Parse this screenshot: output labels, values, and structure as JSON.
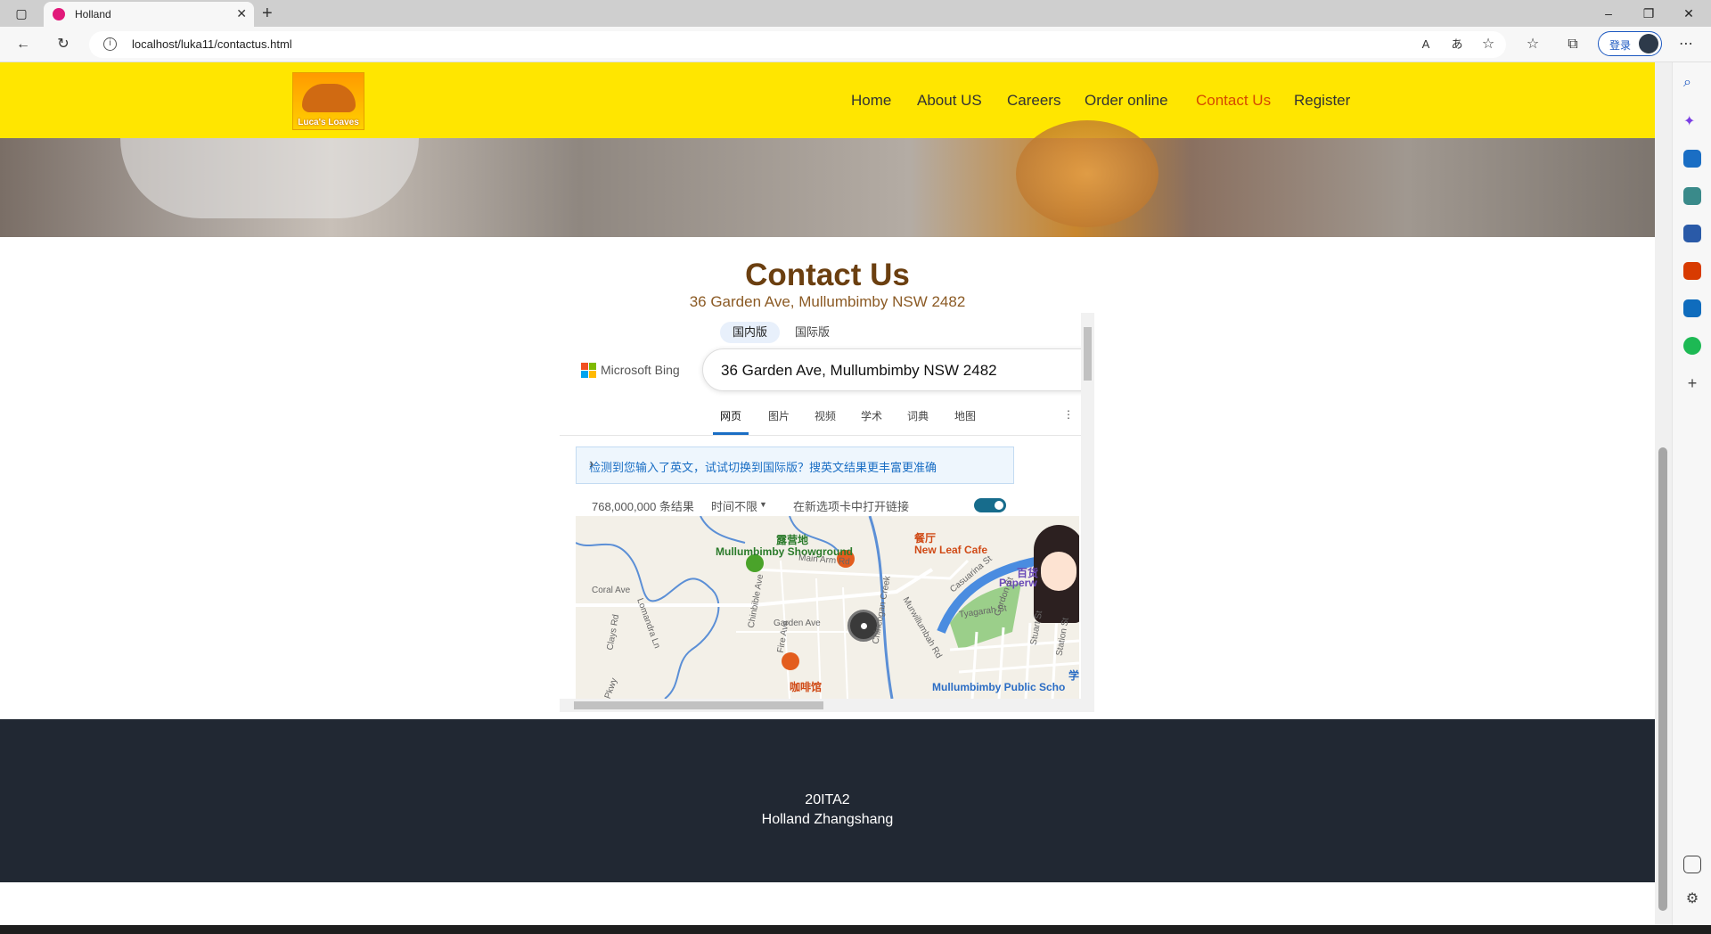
{
  "browser": {
    "tab_title": "Holland",
    "url": "localhost/luka11/contactus.html",
    "login_label": "登录"
  },
  "navbar": {
    "logo_text": "Luca's Loaves",
    "links": [
      "Home",
      "About US",
      "Careers",
      "Order online",
      "Contact Us",
      "Register"
    ],
    "active_color": "#d64a00",
    "bg_color": "#ffe600"
  },
  "content": {
    "heading": "Contact Us",
    "address": "36 Garden Ave, Mullumbimby NSW 2482"
  },
  "bing": {
    "segments": [
      "国内版",
      "国际版"
    ],
    "brand": "Microsoft Bing",
    "query": "36 Garden Ave, Mullumbimby NSW 2482",
    "scopes": [
      "网页",
      "图片",
      "视频",
      "学术",
      "词典",
      "地图"
    ],
    "notice": "检测到您输入了英文，试试切换到国际版？搜英文结果更丰富更准确",
    "result_count": "768,000,000 条结果",
    "time_filter": "时间不限",
    "new_tab_label": "在新选项卡中打开链接",
    "map_labels": {
      "campsite_cn": "露营地",
      "showground": "Mullumbimby Showground",
      "restaurant_cn": "餐厅",
      "cafe": "New Leaf Cafe",
      "coffee_cn": "咖啡馆",
      "school": "Mullumbimby Public Scho",
      "school_cn": "学",
      "paperw": "Paperw",
      "baihuo_cn": "百货",
      "main_arm": "Main Arm Rd",
      "coral": "Coral Ave",
      "garden": "Garden Ave",
      "clays": "Clays Rd",
      "lomandra": "Lomandra Ln",
      "tyagarah": "Tyagarah St",
      "stuart": "Stuart St",
      "station": "Station St",
      "gordon": "Gordon St",
      "casuarina": "Casuarina St",
      "chinbible": "Chinbible Ave",
      "fire": "Fire Ave",
      "chinchile_creek": "Chincogan Creek",
      "murwillumbah": "Murwillumbah Rd",
      "pkwy": "Pkwy"
    }
  },
  "footer": {
    "line1": "20ITA2",
    "line2": "Holland Zhangshang"
  }
}
